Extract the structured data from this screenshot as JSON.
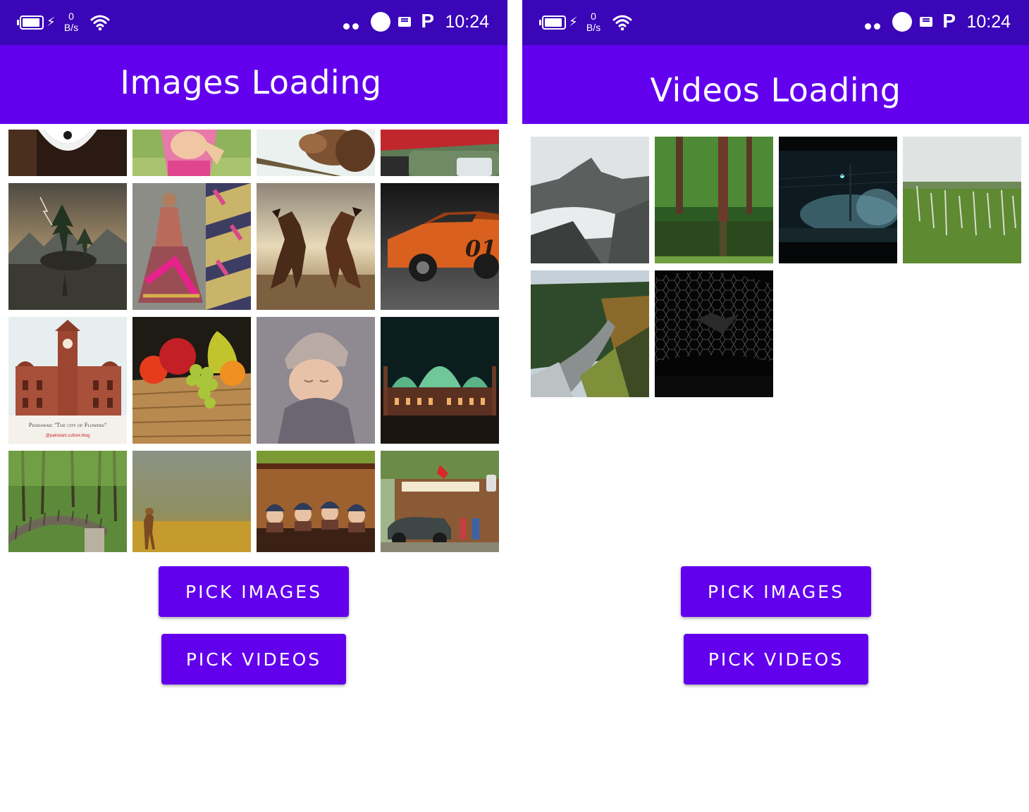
{
  "status_bar": {
    "time": "10:24",
    "net_speed_value": "0",
    "net_speed_unit": "B/s",
    "battery_icon": "battery-charging-icon",
    "wifi_icon": "wifi-icon",
    "notification_icons": [
      "dots-icon",
      "circle-icon",
      "message-icon",
      "parking-app-icon"
    ]
  },
  "colors": {
    "status_bar": "#3a06b8",
    "app_bar": "#6200ee",
    "button": "#6200ee",
    "button_text": "#ffffff",
    "background": "#ffffff"
  },
  "screens": [
    {
      "title": "Images Loading",
      "grid_label": "images",
      "items": [
        "partial-portrait-collar",
        "partial-girl-pink-dress",
        "partial-squirrel",
        "partial-red-truck",
        "lake-island-tree-lightning",
        "woman-embroidered-dress",
        "rearing-horses",
        "orange-muscle-car",
        "peshawar-clock-tower",
        "fruit-basket",
        "sleeping-baby-knit-hat",
        "mosque-night-green-domes",
        "garden-wooden-bridge",
        "fawn-in-field",
        "dolls-in-trunk",
        "vintage-gas-station"
      ],
      "caption_line1": "Peshawar: \"The city of Flowers\"",
      "caption_line2": "@pakistani.culture.blog",
      "car_number": "01",
      "buttons": {
        "pick_images": "PICK IMAGES",
        "pick_videos": "PICK VIDEOS"
      }
    },
    {
      "title": "Videos Loading",
      "grid_label": "videos",
      "items": [
        "snowy-mountain-valley",
        "forest-lake-reflection",
        "foggy-night-street",
        "grass-meadow",
        "forest-road-curve",
        "dark-hexagon-grille"
      ],
      "buttons": {
        "pick_images": "PICK IMAGES",
        "pick_videos": "PICK VIDEOS"
      }
    }
  ]
}
